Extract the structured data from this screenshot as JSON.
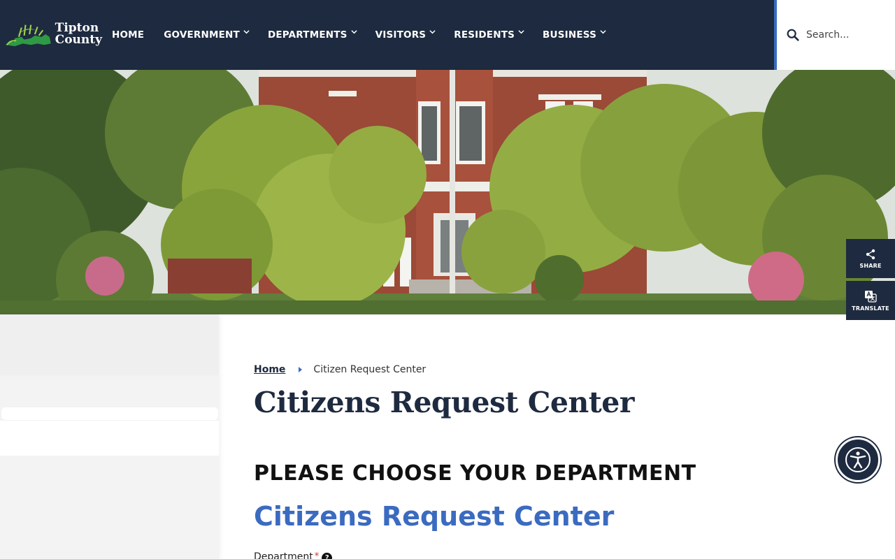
{
  "logo": {
    "line1": "Tipton",
    "line2": "County"
  },
  "nav": {
    "items": [
      {
        "label": "HOME"
      },
      {
        "label": "GOVERNMENT"
      },
      {
        "label": "DEPARTMENTS"
      },
      {
        "label": "VISITORS"
      },
      {
        "label": "RESIDENTS"
      },
      {
        "label": "BUSINESS"
      }
    ]
  },
  "search": {
    "placeholder": "Search..."
  },
  "side_tools": {
    "share_label": "SHARE",
    "translate_label": "TRANSLATE"
  },
  "breadcrumb": {
    "home": "Home",
    "current": "Citizen Request Center"
  },
  "main": {
    "title": "Citizens Request Center",
    "section_heading": "PLEASE CHOOSE YOUR DEPARTMENT",
    "form_title": "Citizens Request Center",
    "department_label": "Department",
    "required_mark": "*",
    "help_mark": "?"
  },
  "colors": {
    "header_bg": "#1e2a3f",
    "accent": "#3b6bc0",
    "required": "#d32f2f"
  }
}
